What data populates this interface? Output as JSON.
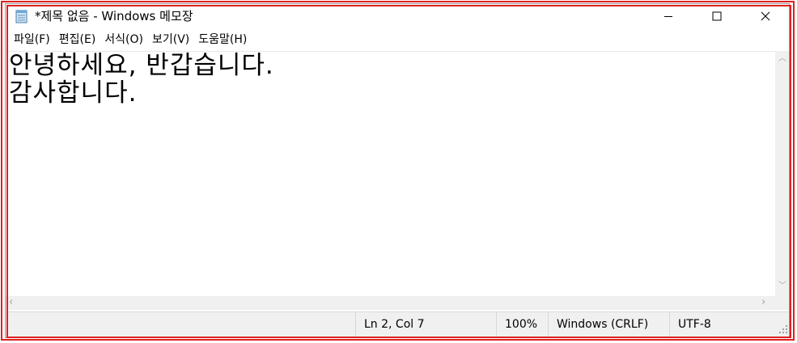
{
  "window": {
    "title": "*제목 없음 - Windows 메모장",
    "controls": {
      "minimize": "minimize-icon",
      "maximize": "maximize-icon",
      "close": "close-icon"
    }
  },
  "menu": {
    "items": [
      {
        "label": "파일(F)"
      },
      {
        "label": "편집(E)"
      },
      {
        "label": "서식(O)"
      },
      {
        "label": "보기(V)"
      },
      {
        "label": "도움말(H)"
      }
    ]
  },
  "editor": {
    "lines": [
      "안녕하세요, 반갑습니다.",
      "감사합니다."
    ]
  },
  "status": {
    "position": "Ln 2, Col 7",
    "zoom": "100%",
    "line_ending": "Windows (CRLF)",
    "encoding": "UTF-8"
  },
  "colors": {
    "highlight_frame": "#e02020",
    "status_bg": "#f0f0f0"
  }
}
